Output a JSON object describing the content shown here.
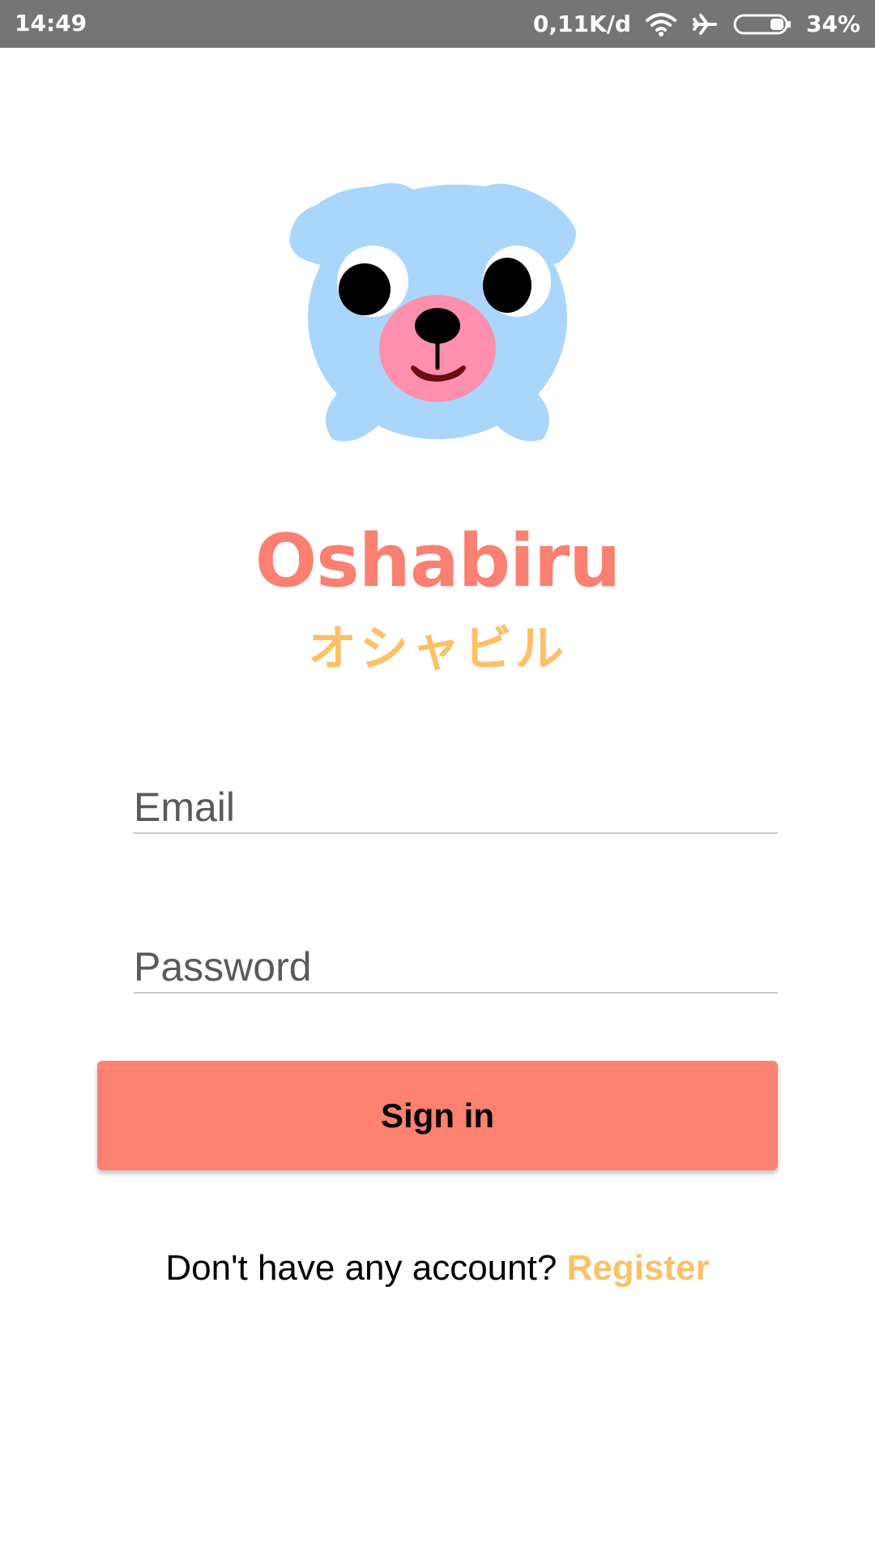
{
  "status_bar": {
    "time": "14:49",
    "network_speed": "0,11K/d",
    "battery_percent": "34%",
    "battery_level": 0.34,
    "icons": [
      "wifi-icon",
      "airplane-mode-icon",
      "battery-icon"
    ]
  },
  "brand": {
    "title": "Oshabiru",
    "subtitle": "オシャビル",
    "mascot_icon": "bear-mascot-icon"
  },
  "form": {
    "email_placeholder": "Email",
    "email_value": "",
    "password_placeholder": "Password",
    "password_value": "",
    "sign_in_label": "Sign in"
  },
  "footer": {
    "prompt": "Don't have any account?",
    "register_label": "Register"
  },
  "colors": {
    "status_bar": "#757575",
    "title": "#fa8072",
    "accent": "#fcc067",
    "button": "#ff8170",
    "mascot_body": "#aad6fb",
    "mascot_snout": "#ff8fae"
  }
}
